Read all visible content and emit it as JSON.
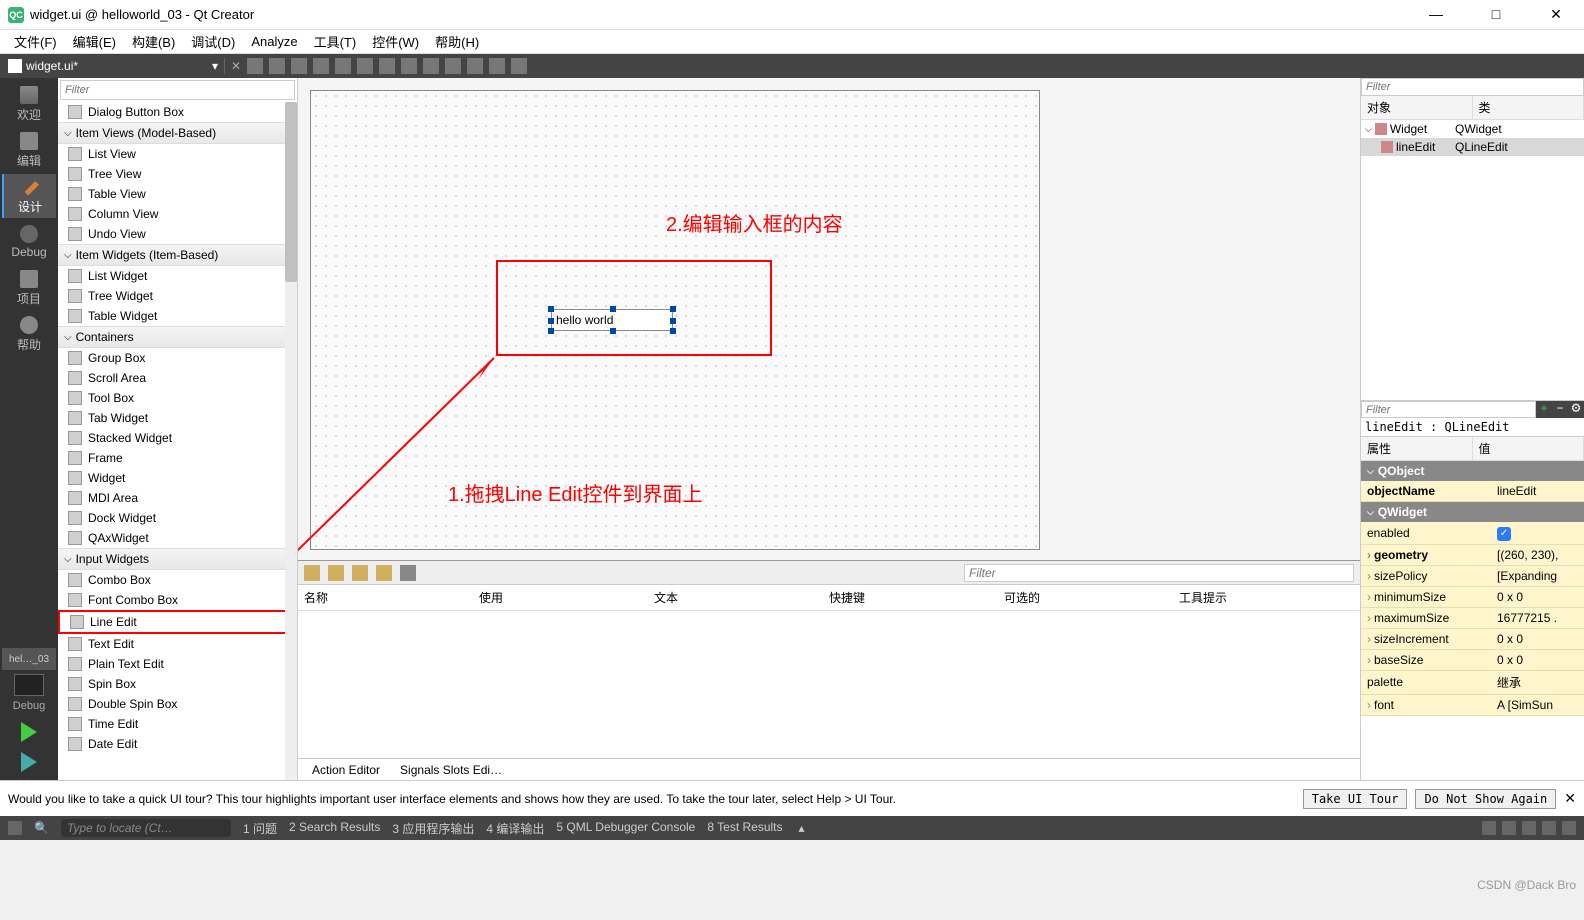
{
  "window": {
    "title": "widget.ui @ helloworld_03 - Qt Creator",
    "qc_label": "QC"
  },
  "menubar": [
    "文件(F)",
    "编辑(E)",
    "构建(B)",
    "调试(D)",
    "Analyze",
    "工具(T)",
    "控件(W)",
    "帮助(H)"
  ],
  "toolbar_file": "widget.ui*",
  "leftbar": {
    "items": [
      "欢迎",
      "编辑",
      "设计",
      "Debug",
      "项目",
      "帮助"
    ],
    "tab": "hel…_03",
    "debug": "Debug"
  },
  "widgetbox": {
    "filter_placeholder": "Filter",
    "categories": [
      {
        "name": "",
        "items": [
          "Dialog Button Box"
        ]
      },
      {
        "name": "Item Views (Model-Based)",
        "items": [
          "List View",
          "Tree View",
          "Table View",
          "Column View",
          "Undo View"
        ]
      },
      {
        "name": "Item Widgets (Item-Based)",
        "items": [
          "List Widget",
          "Tree Widget",
          "Table Widget"
        ]
      },
      {
        "name": "Containers",
        "items": [
          "Group Box",
          "Scroll Area",
          "Tool Box",
          "Tab Widget",
          "Stacked Widget",
          "Frame",
          "Widget",
          "MDI Area",
          "Dock Widget",
          "QAxWidget"
        ]
      },
      {
        "name": "Input Widgets",
        "items": [
          "Combo Box",
          "Font Combo Box",
          "Line Edit",
          "Text Edit",
          "Plain Text Edit",
          "Spin Box",
          "Double Spin Box",
          "Time Edit",
          "Date Edit"
        ]
      }
    ]
  },
  "canvas": {
    "lineedit_text": "hello world",
    "annot1": "2.编辑输入框的内容",
    "annot2": "1.拖拽Line Edit控件到界面上"
  },
  "bottompanel": {
    "filter_placeholder": "Filter",
    "headers": [
      "名称",
      "使用",
      "文本",
      "快捷键",
      "可选的",
      "工具提示"
    ],
    "tabs": [
      "Action Editor",
      "Signals Slots Edi…"
    ]
  },
  "rightpanel": {
    "filter1": "Filter",
    "obj_headers": [
      "对象",
      "类"
    ],
    "tree": [
      {
        "name": "Widget",
        "cls": "QWidget",
        "indent": 0,
        "exp": true
      },
      {
        "name": "lineEdit",
        "cls": "QLineEdit",
        "indent": 1,
        "sel": true
      }
    ],
    "filter2": "Filter",
    "selected": "lineEdit : QLineEdit",
    "prop_headers": [
      "属性",
      "值"
    ],
    "props": [
      {
        "group": "QObject"
      },
      {
        "k": "objectName",
        "v": "lineEdit",
        "bold": true
      },
      {
        "group": "QWidget"
      },
      {
        "k": "enabled",
        "v": "",
        "chk": true
      },
      {
        "k": "geometry",
        "v": "[(260, 230),",
        "bold": true,
        "exp": true
      },
      {
        "k": "sizePolicy",
        "v": "[Expanding",
        "exp": true
      },
      {
        "k": "minimumSize",
        "v": "0 x 0",
        "exp": true
      },
      {
        "k": "maximumSize",
        "v": "16777215 .",
        "exp": true
      },
      {
        "k": "sizeIncrement",
        "v": "0 x 0",
        "exp": true
      },
      {
        "k": "baseSize",
        "v": "0 x 0",
        "exp": true
      },
      {
        "k": "palette",
        "v": "继承"
      },
      {
        "k": "font",
        "v": "A [SimSun",
        "exp": true
      }
    ]
  },
  "tourbar": {
    "msg": "Would you like to take a quick UI tour? This tour highlights important user interface elements and shows how they are used. To take the tour later, select Help > UI Tour.",
    "btn1": "Take UI Tour",
    "btn2": "Do Not Show Again"
  },
  "statusbar": {
    "locate": "Type to locate (Ct…",
    "items": [
      "1 问题",
      "2 Search Results",
      "3 应用程序输出",
      "4 编译输出",
      "5 QML Debugger Console",
      "8 Test Results"
    ]
  },
  "watermark": "CSDN @Dack Bro"
}
